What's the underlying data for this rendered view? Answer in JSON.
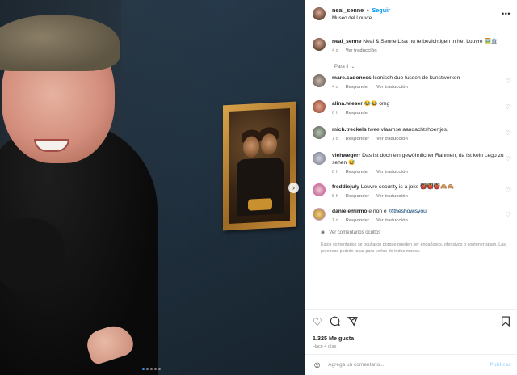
{
  "post": {
    "username": "neal_senne",
    "follow_label": "Seguir",
    "separator": "•",
    "location": "Museo del Louvre",
    "more_icon": "more-horizontal-icon"
  },
  "caption": {
    "username": "neal_senne",
    "text": "Neal & Senne Lisa nu te bezichtigen in het Louvre 🖼️🏛️",
    "age": "4 d",
    "translate": "Ver traducción"
  },
  "sort_label": "Para ti",
  "comments": [
    {
      "username": "mare.sadoness",
      "text": "Iconisch duo tussen de kunstwerken",
      "age": "4 d",
      "reply": "Responder",
      "translate": "Ver traducción"
    },
    {
      "username": "alina.wieser",
      "text": "😂😂 omg",
      "age": "6 h",
      "reply": "Responder",
      "translate": ""
    },
    {
      "username": "mich.treckels",
      "text": "twee vlaamse aandachtshoertjes.",
      "age": "1 d",
      "reply": "Responder",
      "translate": "Ver traducción"
    },
    {
      "username": "viehwegerr",
      "text": "Das ist doch ein gewöhnlicher Rahmen, da ist kein Lego zu sehen 😅",
      "age": "8 h",
      "reply": "Responder",
      "translate": "Ver traducción"
    },
    {
      "username": "freddiejuly",
      "text": "Louvre security is a joke 👹👹👹🙈🙈",
      "age": "5 h",
      "reply": "Responder",
      "translate": "Ver traducción"
    },
    {
      "username": "danielemirmo",
      "text": "e non è ",
      "mention": "@theshowisyou",
      "age": "1 d",
      "reply": "Responder",
      "translate": "Ver traducción"
    }
  ],
  "hidden_comments": {
    "label": "Ver comentarios ocultos",
    "note": "Estos comentarios se ocultaron porque pueden ser engañosos, ofensivos o contener spam. Las personas podrán tocar para verlos de todos modos."
  },
  "stats": {
    "likes": "1.325 Me gusta",
    "posted": "Hace 4 días"
  },
  "composer": {
    "placeholder": "Agrega un comentario...",
    "publish": "Publicar"
  },
  "carousel": {
    "total": 5,
    "active": 1
  },
  "colors": {
    "link": "#0095f6",
    "muted": "#8e8e8e",
    "text": "#262626"
  }
}
